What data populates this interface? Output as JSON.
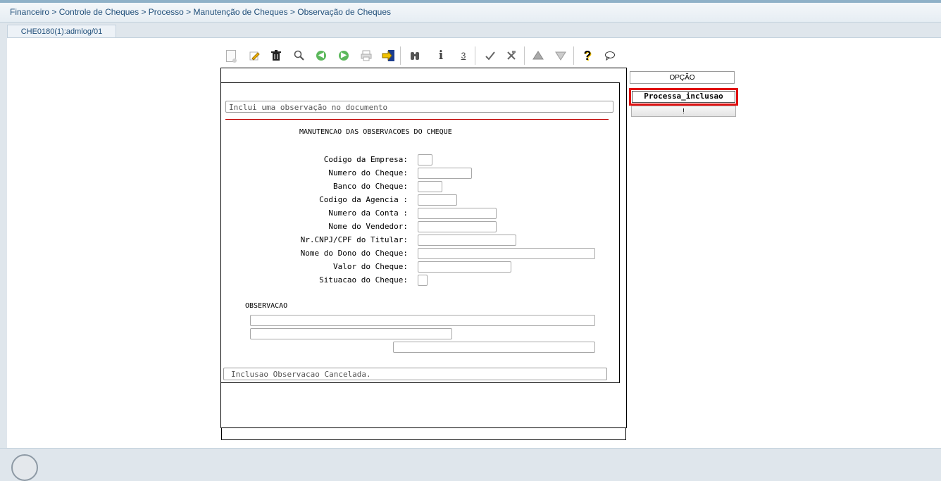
{
  "breadcrumb": "Financeiro > Controle de Cheques > Processo > Manutenção de Cheques > Observação de Cheques",
  "tab": {
    "label": "CHE0180(1):admlog/01"
  },
  "toolbar": {
    "icons": [
      "new-doc-icon",
      "edit-icon",
      "delete-icon",
      "search-icon",
      "previous-icon",
      "next-icon",
      "print-icon",
      "exit-icon",
      "binoculars-icon",
      "info-icon",
      "number-icon",
      "confirm-icon",
      "cancel-icon",
      "up-icon",
      "down-icon",
      "help-icon",
      "chat-icon"
    ],
    "info_glyph": "i",
    "number_glyph": "3",
    "help_glyph": "?"
  },
  "message": "Inclui uma observação no documento",
  "form": {
    "title": "MANUTENCAO DAS OBSERVACOES DO CHEQUE",
    "labels": {
      "empresa": "Codigo da Empresa:",
      "numero_cheque": "Numero do Cheque:",
      "banco": "Banco do Cheque:",
      "agencia": "Codigo da Agencia :",
      "conta": "Numero da Conta :",
      "vendedor": "Nome do Vendedor:",
      "cnpj": "Nr.CNPJ/CPF do Titular:",
      "dono": "Nome do Dono do Cheque:",
      "valor": "Valor do Cheque:",
      "situacao": "Situacao do Cheque:"
    },
    "observacao_label": "OBSERVACAO"
  },
  "status": "Inclusao Observacao Cancelada.",
  "side_panel": {
    "opcao_label": "OPÇÃO",
    "processa_label": "Processa_inclusao",
    "bang_label": "!"
  },
  "colors": {
    "highlight": "#e01010",
    "separator_line": "#c00000",
    "link": "#1f4e79"
  }
}
